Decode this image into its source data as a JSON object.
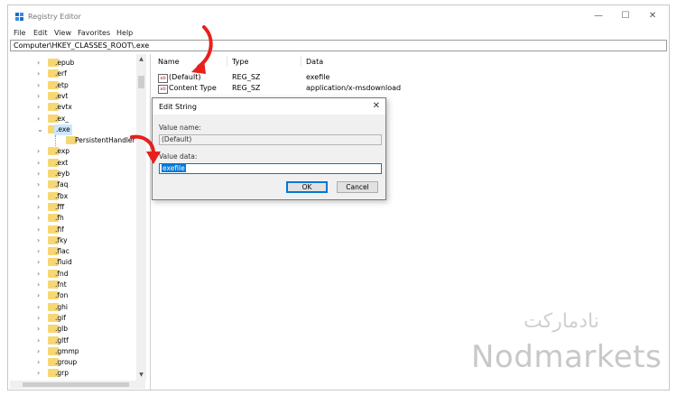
{
  "window": {
    "title": "Registry Editor",
    "controls": {
      "minimize": "—",
      "maximize": "☐",
      "close": "✕"
    }
  },
  "menu": [
    "File",
    "Edit",
    "View",
    "Favorites",
    "Help"
  ],
  "address": "Computer\\HKEY_CLASSES_ROOT\\.exe",
  "tree": {
    "items": [
      {
        "label": ".epub",
        "expanded": false
      },
      {
        "label": ".erf",
        "expanded": false
      },
      {
        "label": ".etp",
        "expanded": false
      },
      {
        "label": ".evt",
        "expanded": false
      },
      {
        "label": ".evtx",
        "expanded": false
      },
      {
        "label": ".ex_",
        "expanded": false
      },
      {
        "label": ".exe",
        "expanded": true,
        "selected": true
      },
      {
        "label": "PersistentHandler",
        "child": true
      },
      {
        "label": ".exp",
        "expanded": false
      },
      {
        "label": ".ext",
        "expanded": false
      },
      {
        "label": ".eyb",
        "expanded": false
      },
      {
        "label": ".faq",
        "expanded": false
      },
      {
        "label": ".fbx",
        "expanded": false
      },
      {
        "label": ".fff",
        "expanded": false
      },
      {
        "label": ".fh",
        "expanded": false
      },
      {
        "label": ".fif",
        "expanded": false
      },
      {
        "label": ".fky",
        "expanded": false
      },
      {
        "label": ".flac",
        "expanded": false
      },
      {
        "label": ".fluid",
        "expanded": false
      },
      {
        "label": ".fnd",
        "expanded": false
      },
      {
        "label": ".fnt",
        "expanded": false
      },
      {
        "label": ".fon",
        "expanded": false
      },
      {
        "label": ".ghi",
        "expanded": false
      },
      {
        "label": ".gif",
        "expanded": false
      },
      {
        "label": ".glb",
        "expanded": false
      },
      {
        "label": ".gltf",
        "expanded": false
      },
      {
        "label": ".gmmp",
        "expanded": false
      },
      {
        "label": ".group",
        "expanded": false
      },
      {
        "label": ".grp",
        "expanded": false
      }
    ]
  },
  "list": {
    "columns": [
      "Name",
      "Type",
      "Data"
    ],
    "rows": [
      {
        "name": "(Default)",
        "type": "REG_SZ",
        "data": "exefile"
      },
      {
        "name": "Content Type",
        "type": "REG_SZ",
        "data": "application/x-msdownload"
      }
    ]
  },
  "dialog": {
    "title": "Edit String",
    "close": "✕",
    "value_name_label": "Value name:",
    "value_name": "(Default)",
    "value_data_label": "Value data:",
    "value_data": "exefile",
    "ok_label": "OK",
    "cancel_label": "Cancel"
  },
  "watermark": {
    "farsi": "نادمارکت",
    "english": "Nodmarkets"
  },
  "colors": {
    "arrow": "#e8201c",
    "folder": "#f6d774",
    "selection": "#cce8ff",
    "accent": "#0078d7"
  }
}
